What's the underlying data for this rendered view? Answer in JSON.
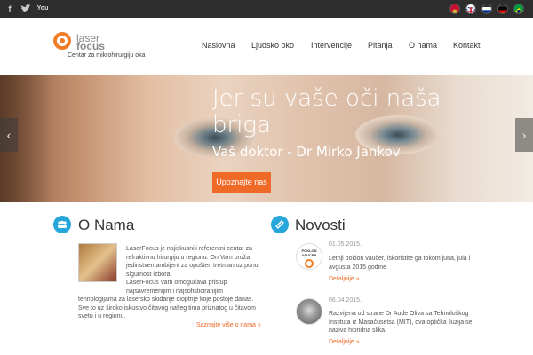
{
  "social": {
    "icons": [
      "facebook-icon",
      "twitter-icon",
      "youtube-icon"
    ],
    "youtube_label": "You"
  },
  "languages": [
    "montenegro-flag-icon",
    "uk-flag-icon",
    "russia-flag-icon",
    "germany-flag-icon",
    "brazil-flag-icon"
  ],
  "logo": {
    "laser": "laser",
    "focus": "focus",
    "tagline": "Centar za mikrohirurgiju oka"
  },
  "nav": [
    {
      "label": "Naslovna"
    },
    {
      "label": "Ljudsko oko"
    },
    {
      "label": "Intervencije"
    },
    {
      "label": "Pitanja"
    },
    {
      "label": "O nama"
    },
    {
      "label": "Kontakt"
    }
  ],
  "hero": {
    "title": "Jer su vaše oči naša briga",
    "subtitle": "Vaš doktor - Dr Mirko Jankov",
    "button": "Upoznajte nas",
    "prev": "‹",
    "next": "›"
  },
  "about": {
    "title": "O Nama",
    "lines_right": [
      "LaserFocus je najiskusniji referentni centar za",
      "refraktivnu hirurgiju u regionu. On Vam pruža",
      "jedinstven ambijent za opušten tretman uz punu",
      "sigurnost izbora.",
      "LaserFocus Vam omogućava pristup",
      "najsavremenijim i najsofisticiranijim"
    ],
    "lines_full": [
      "tehnologijama za lasersko skidanje dioptrije koje postoje danas.",
      "Sve to uz široko iskustvo čitavog našeg tima priznatog u čitavom",
      "svetu i u regionu."
    ],
    "more": "Saznajte više o nama »"
  },
  "news": {
    "title": "Novosti",
    "items": [
      {
        "date": "01.05.2015.",
        "text": [
          "Letnji poklon vaučer, iskoristite ga tokom juna, jula i",
          "avgusta 2015 godine"
        ],
        "link": "Detaljnije »",
        "thumb": "POKLON VAUCER"
      },
      {
        "date": "06.04.2015.",
        "text": [
          "Razvijena od strane Dr Aude Oliva sa Tehnološkog",
          "Instituta iz Masačusetsa (MIT), ova optička iluzija se",
          "naziva hibridna slika."
        ],
        "link": "Detaljnije »"
      }
    ]
  },
  "colors": {
    "accent": "#ee6a26",
    "icon_blue": "#26a6d9",
    "topbar": "#2d2d2d"
  }
}
